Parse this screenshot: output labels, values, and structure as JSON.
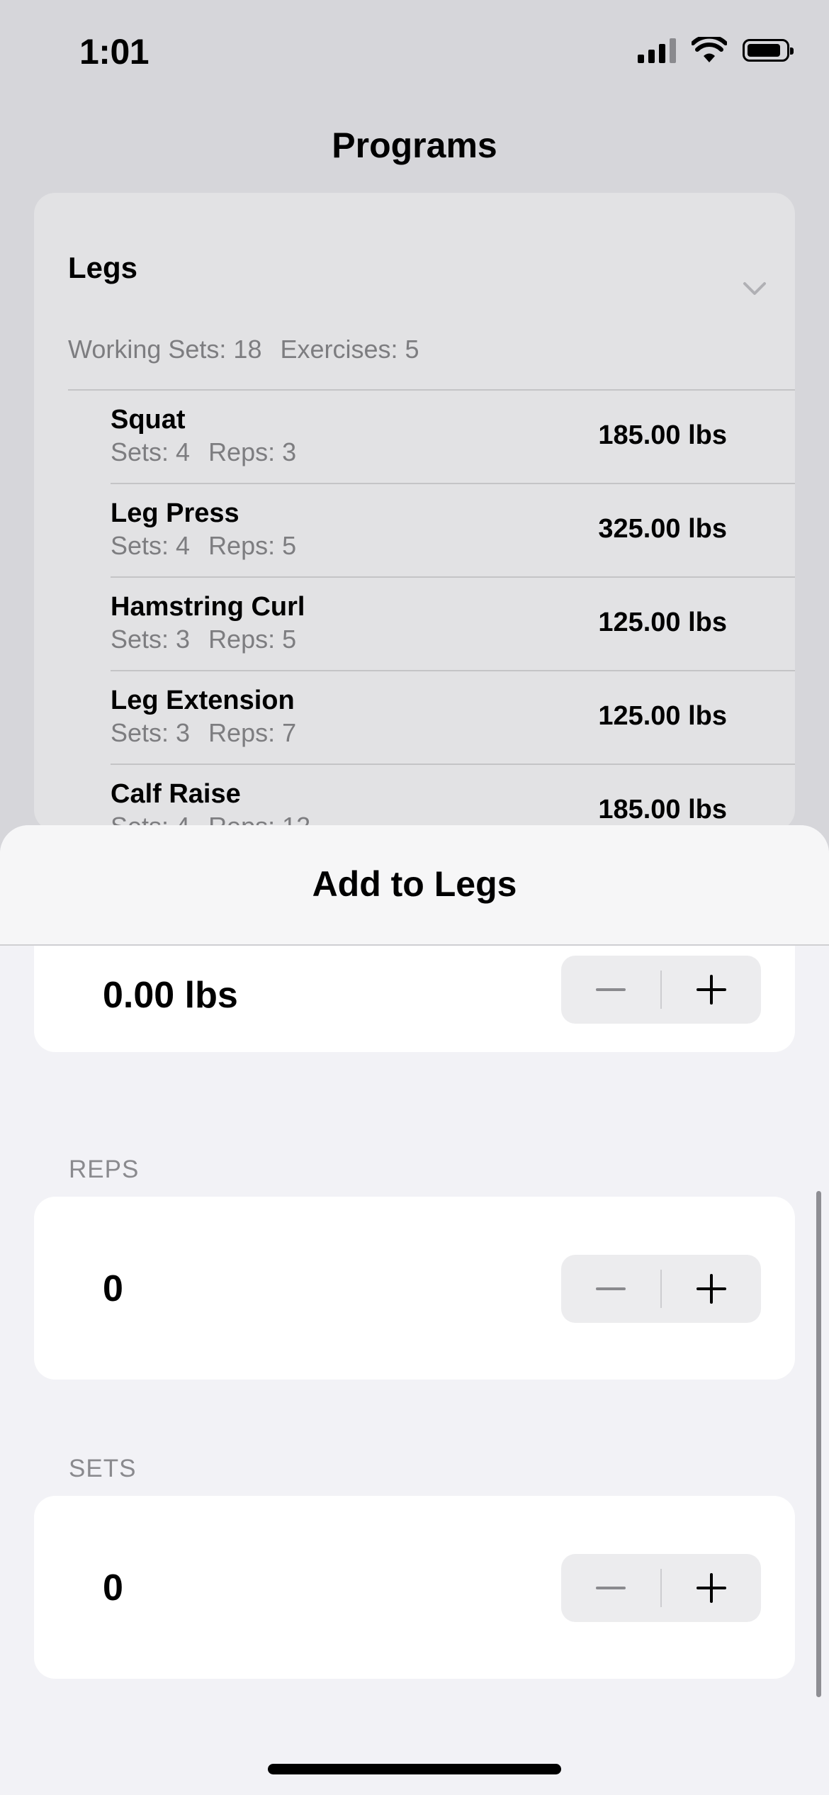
{
  "status_bar": {
    "time": "1:01"
  },
  "screen": {
    "title": "Programs"
  },
  "program": {
    "name": "Legs",
    "working_sets": "Working Sets: 18",
    "exercises_count": "Exercises: 5",
    "exercises": [
      {
        "name": "Squat",
        "sets": "Sets: 4",
        "reps": "Reps: 3",
        "weight": "185.00 lbs"
      },
      {
        "name": "Leg Press",
        "sets": "Sets: 4",
        "reps": "Reps: 5",
        "weight": "325.00 lbs"
      },
      {
        "name": "Hamstring Curl",
        "sets": "Sets: 3",
        "reps": "Reps: 5",
        "weight": "125.00 lbs"
      },
      {
        "name": "Leg Extension",
        "sets": "Sets: 3",
        "reps": "Reps: 7",
        "weight": "125.00 lbs"
      },
      {
        "name": "Calf Raise",
        "sets": "Sets: 4",
        "reps": "Reps: 12",
        "weight": "185.00 lbs"
      }
    ]
  },
  "sheet": {
    "title": "Add to Legs",
    "weight": {
      "value": "0.00 lbs"
    },
    "reps": {
      "label": "REPS",
      "value": "0"
    },
    "sets": {
      "label": "SETS",
      "value": "0"
    }
  },
  "icons": {
    "signal": "cellular-signal-icon",
    "wifi": "wifi-icon",
    "battery": "battery-icon",
    "chevron": "chevron-down-icon",
    "minus": "minus-icon",
    "plus": "plus-icon"
  },
  "colors": {
    "background": "#d6d6da",
    "card": "#e2e2e4",
    "sheet": "#f2f2f6",
    "secondary_text": "#7d7d80",
    "stepper": "#ececee"
  }
}
